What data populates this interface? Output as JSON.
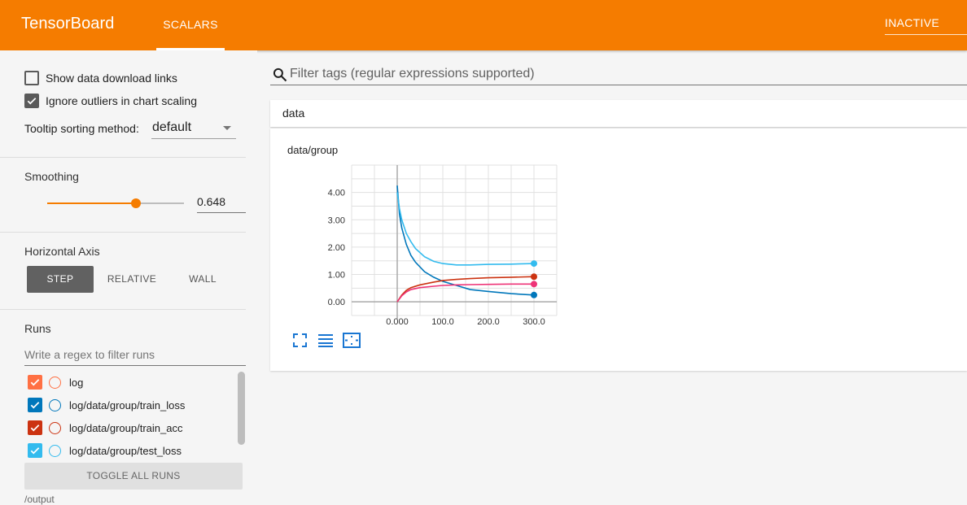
{
  "app": {
    "title": "TensorBoard",
    "tab": "SCALARS",
    "status": "INACTIVE"
  },
  "sidebar": {
    "show_download": {
      "label": "Show data download links",
      "checked": false
    },
    "ignore_outliers": {
      "label": "Ignore outliers in chart scaling",
      "checked": true
    },
    "tooltip": {
      "label": "Tooltip sorting method:",
      "value": "default"
    },
    "smoothing": {
      "label": "Smoothing",
      "value": "0.648",
      "fraction": 0.648
    },
    "horizontal_axis": {
      "label": "Horizontal Axis",
      "options": [
        "STEP",
        "RELATIVE",
        "WALL"
      ],
      "selected": "STEP"
    },
    "runs": {
      "label": "Runs",
      "filter_placeholder": "Write a regex to filter runs",
      "items": [
        {
          "name": "log",
          "color": "#ff7043",
          "checked": true
        },
        {
          "name": "log/data/group/train_loss",
          "color": "#0077bb",
          "checked": true
        },
        {
          "name": "log/data/group/train_acc",
          "color": "#cc3311",
          "checked": true
        },
        {
          "name": "log/data/group/test_loss",
          "color": "#33bbee",
          "checked": true
        }
      ],
      "toggle_label": "TOGGLE ALL RUNS",
      "output_label": "/output"
    }
  },
  "main": {
    "filter_placeholder": "Filter tags (regular expressions supported)",
    "category": "data",
    "card_title": "data/group"
  },
  "chart_data": {
    "type": "line",
    "title": "data/group",
    "xlim": [
      -100,
      350
    ],
    "ylim": [
      -0.5,
      5.0
    ],
    "x_ticks": [
      "0.000",
      "100.0",
      "200.0",
      "300.0"
    ],
    "y_ticks": [
      "0.00",
      "1.00",
      "2.00",
      "3.00",
      "4.00"
    ],
    "grid": true,
    "series": [
      {
        "name": "log/data/group/train_loss",
        "color": "#0077bb",
        "x": [
          0,
          5,
          10,
          20,
          30,
          40,
          60,
          80,
          100,
          130,
          160,
          200,
          250,
          300
        ],
        "values": [
          4.25,
          3.2,
          2.7,
          2.1,
          1.7,
          1.45,
          1.1,
          0.9,
          0.75,
          0.6,
          0.45,
          0.38,
          0.3,
          0.25
        ]
      },
      {
        "name": "log/data/group/test_loss",
        "color": "#33bbee",
        "x": [
          0,
          5,
          10,
          20,
          30,
          40,
          60,
          80,
          100,
          130,
          160,
          200,
          250,
          300
        ],
        "values": [
          4.0,
          3.4,
          3.0,
          2.5,
          2.2,
          1.95,
          1.65,
          1.48,
          1.4,
          1.35,
          1.35,
          1.37,
          1.38,
          1.4
        ]
      },
      {
        "name": "log/data/group/train_acc",
        "color": "#cc3311",
        "x": [
          0,
          10,
          20,
          30,
          50,
          80,
          100,
          130,
          160,
          200,
          250,
          300
        ],
        "values": [
          0.0,
          0.25,
          0.42,
          0.52,
          0.62,
          0.72,
          0.78,
          0.82,
          0.85,
          0.88,
          0.9,
          0.92
        ]
      },
      {
        "name": "log",
        "color": "#ee3377",
        "x": [
          0,
          10,
          20,
          30,
          50,
          80,
          100,
          130,
          160,
          200,
          250,
          300
        ],
        "values": [
          0.0,
          0.22,
          0.36,
          0.45,
          0.52,
          0.57,
          0.6,
          0.62,
          0.63,
          0.64,
          0.65,
          0.65
        ]
      }
    ]
  }
}
